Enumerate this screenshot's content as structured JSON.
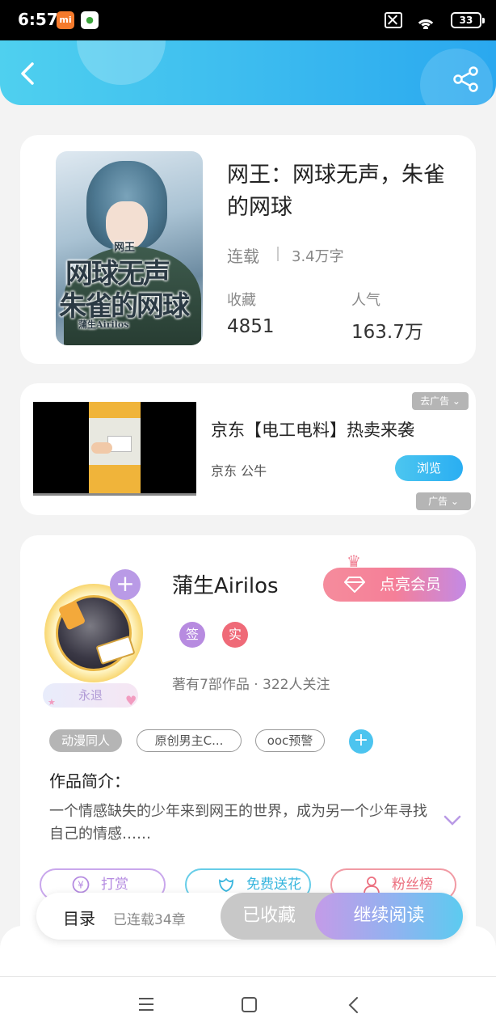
{
  "status_bar": {
    "time": "6:57",
    "app_badge_1": "mi",
    "battery": "33"
  },
  "header": {
    "back_icon": "back-arrow-icon",
    "share_icon": "share-icon"
  },
  "book": {
    "cover": {
      "series": "网王",
      "title_line1": "网球无声",
      "title_line2": "朱雀的网球",
      "author": "蒲生Airilos"
    },
    "title": "网王：网球无声，朱雀的网球",
    "status": "连载",
    "word_count": "3.4万字",
    "favorites_label": "收藏",
    "favorites_value": "4851",
    "popularity_label": "人气",
    "popularity_value": "163.7万"
  },
  "ad": {
    "title": "京东【电工电料】热卖来袭",
    "source": "京东 公牛",
    "browse_label": "浏览",
    "remove_label": "去广告 ⌄",
    "tag_label": "广告 ⌄"
  },
  "author": {
    "name": "蒲生Airilos",
    "vip_label": "点亮会员",
    "badge_sign": "签",
    "badge_real": "实",
    "meta": "著有7部作品 · 322人关注",
    "retired_label": "永退",
    "tags": [
      "动漫同人",
      "原创男主C...",
      "ooc预警"
    ],
    "intro_heading": "作品简介：",
    "intro_text": "一个情感缺失的少年来到网王的世界，成为另一个少年寻找自己的情感……",
    "actions": {
      "tip_label": "打赏",
      "flower_label": "免费送花",
      "fans_label": "粉丝榜"
    }
  },
  "bottom_bar": {
    "toc_label": "目录",
    "chapters_label": "已连载34章",
    "collected_label": "已收藏",
    "continue_label": "继续阅读"
  },
  "colors": {
    "header_gradient_start": "#4fd0ef",
    "header_gradient_end": "#2aa8ef",
    "vip_pink": "#f57f98",
    "accent_purple": "#b78be0",
    "accent_blue": "#4cc4ef"
  }
}
